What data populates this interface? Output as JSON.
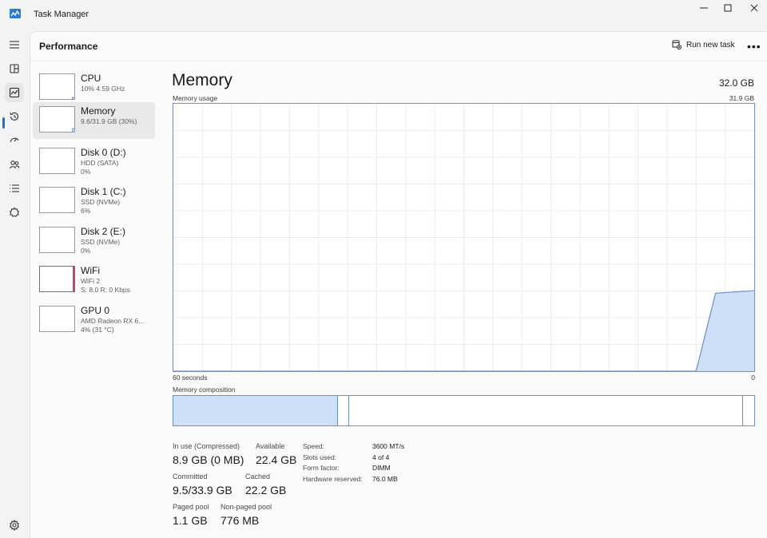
{
  "window": {
    "title": "Task Manager"
  },
  "header": {
    "title": "Performance",
    "run_task_label": "Run new task",
    "more_label": "•••"
  },
  "colors": {
    "accent": "#1a6fd1",
    "memory_fill": "#cde0f7",
    "memory_line": "#6e8fbf",
    "wifi_line": "#c0467a",
    "gpu_line": "#9c6ad1"
  },
  "devices": [
    {
      "name": "CPU",
      "line1": "10% 4.59 GHz",
      "line2": "",
      "icon": "cpu-graph"
    },
    {
      "name": "Memory",
      "line1": "9.6/31.9 GB (30%)",
      "line2": "",
      "icon": "memory-graph"
    },
    {
      "name": "Disk 0 (D:)",
      "line1": "HDD (SATA)",
      "line2": "0%",
      "icon": "disk-graph"
    },
    {
      "name": "Disk 1 (C:)",
      "line1": "SSD (NVMe)",
      "line2": "6%",
      "icon": "disk-graph"
    },
    {
      "name": "Disk 2 (E:)",
      "line1": "SSD (NVMe)",
      "line2": "0%",
      "icon": "disk-graph"
    },
    {
      "name": "WiFi",
      "line1": "WiFi 2",
      "line2": "S: 8.0  R: 0 Kbps",
      "icon": "wifi-graph"
    },
    {
      "name": "GPU 0",
      "line1": "AMD Radeon RX 6...",
      "line2": "4% (31 °C)",
      "icon": "gpu-graph"
    }
  ],
  "memory": {
    "title": "Memory",
    "total": "32.0 GB",
    "usage_label": "Memory usage",
    "usage_max": "31.9 GB",
    "time_left": "60 seconds",
    "time_right": "0",
    "composition_label": "Memory composition",
    "stats": {
      "in_use_label": "In use (Compressed)",
      "in_use_value": "8.9 GB (0 MB)",
      "available_label": "Available",
      "available_value": "22.4 GB",
      "committed_label": "Committed",
      "committed_value": "9.5/33.9 GB",
      "cached_label": "Cached",
      "cached_value": "22.2 GB",
      "paged_label": "Paged pool",
      "paged_value": "1.1 GB",
      "nonpaged_label": "Non-paged pool",
      "nonpaged_value": "776 MB"
    },
    "specs": [
      {
        "label": "Speed:",
        "value": "3600 MT/s"
      },
      {
        "label": "Slots used:",
        "value": "4 of 4"
      },
      {
        "label": "Form factor:",
        "value": "DIMM"
      },
      {
        "label": "Hardware reserved:",
        "value": "76.0 MB"
      }
    ]
  },
  "chart_data": {
    "type": "area",
    "title": "Memory usage",
    "x": [
      60,
      6,
      4,
      0
    ],
    "xlabel": "",
    "ylabel": "",
    "ylim": [
      0,
      31.9
    ],
    "series": [
      {
        "values": [
          0,
          0,
          9.3,
          9.6
        ]
      }
    ],
    "grid": true
  }
}
